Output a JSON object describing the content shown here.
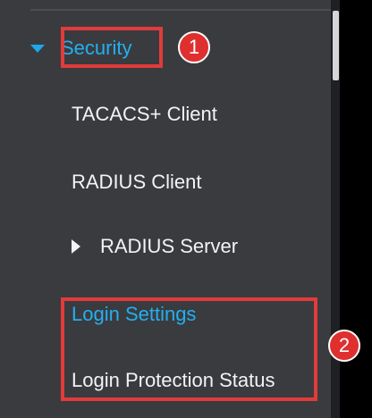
{
  "sidebar": {
    "items": [
      {
        "label": "Security",
        "icon": "chevron-down-icon"
      },
      {
        "label": "TACACS+ Client"
      },
      {
        "label": "RADIUS Client"
      },
      {
        "label": "RADIUS Server",
        "icon": "triangle-right-icon"
      },
      {
        "label": "Login Settings"
      },
      {
        "label": "Login Protection Status"
      }
    ]
  },
  "annotations": {
    "badge_1": "1",
    "badge_2": "2"
  },
  "colors": {
    "sidebar_bg": "#3a3b3f",
    "accent_blue": "#22b0f0",
    "highlight_red": "#e13b3b",
    "badge_red": "#df2f2f"
  }
}
